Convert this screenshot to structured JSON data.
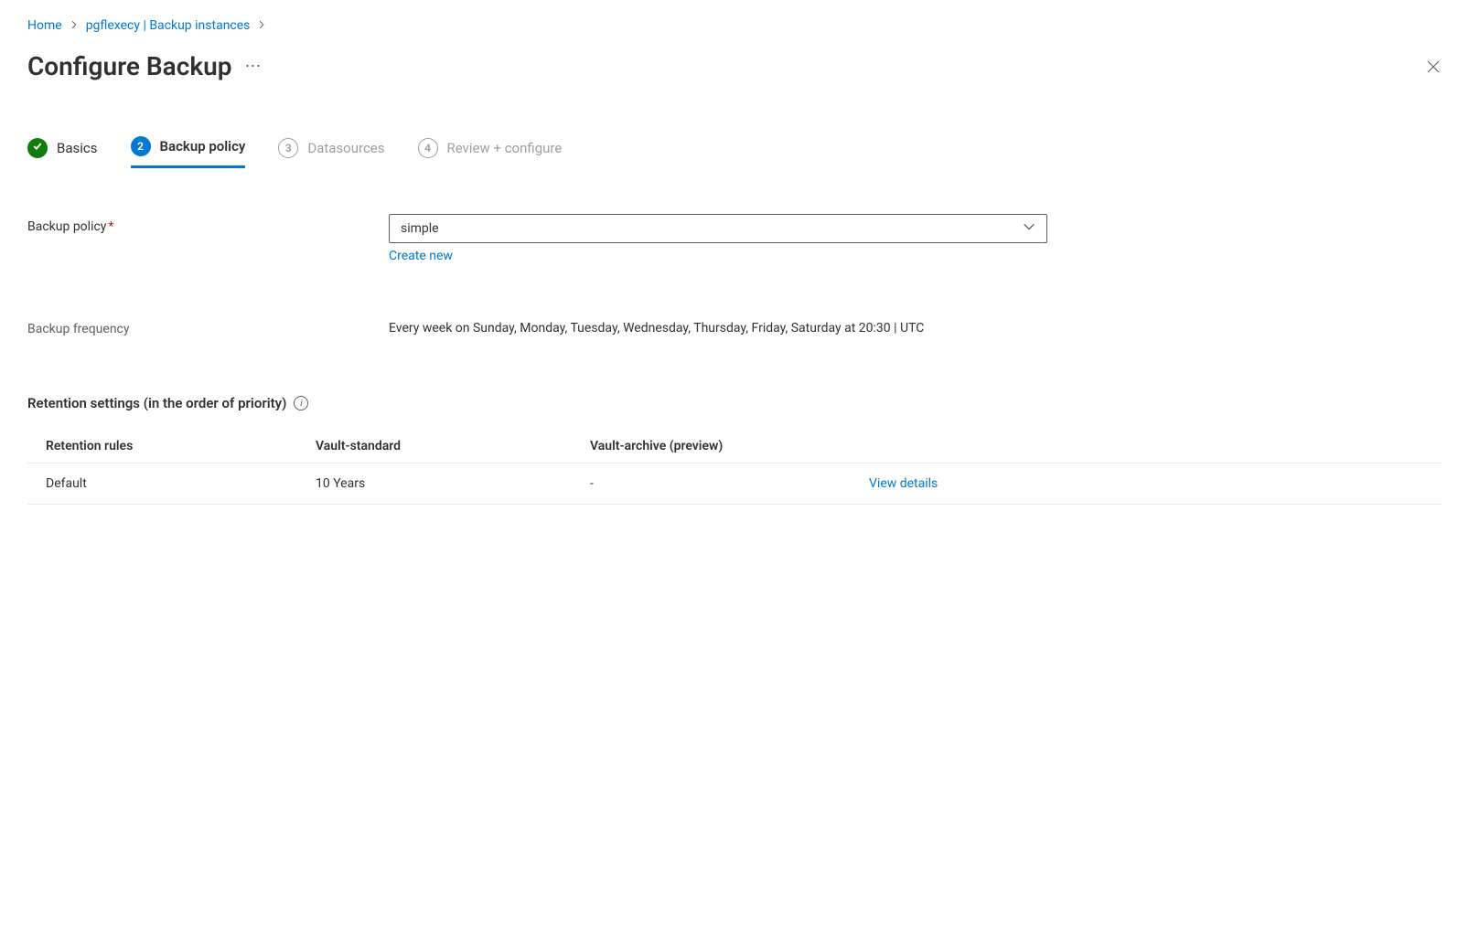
{
  "breadcrumb": {
    "home": "Home",
    "parent": "pgflexecy | Backup instances"
  },
  "page": {
    "title": "Configure Backup"
  },
  "steps": {
    "basics": "Basics",
    "backup_policy": "Backup policy",
    "datasources": "Datasources",
    "review": "Review + configure",
    "num3": "3",
    "num4": "4"
  },
  "form": {
    "policy_label": "Backup policy",
    "policy_value": "simple",
    "create_new": "Create new",
    "frequency_label": "Backup frequency",
    "frequency_value": "Every week on Sunday, Monday, Tuesday, Wednesday, Thursday, Friday, Saturday at 20:30 | UTC"
  },
  "retention": {
    "section_title": "Retention settings (in the order of priority)",
    "headers": {
      "rules": "Retention rules",
      "standard": "Vault-standard",
      "archive": "Vault-archive (preview)"
    },
    "row": {
      "rules": "Default",
      "standard": "10 Years",
      "archive": "-",
      "action": "View details"
    }
  }
}
